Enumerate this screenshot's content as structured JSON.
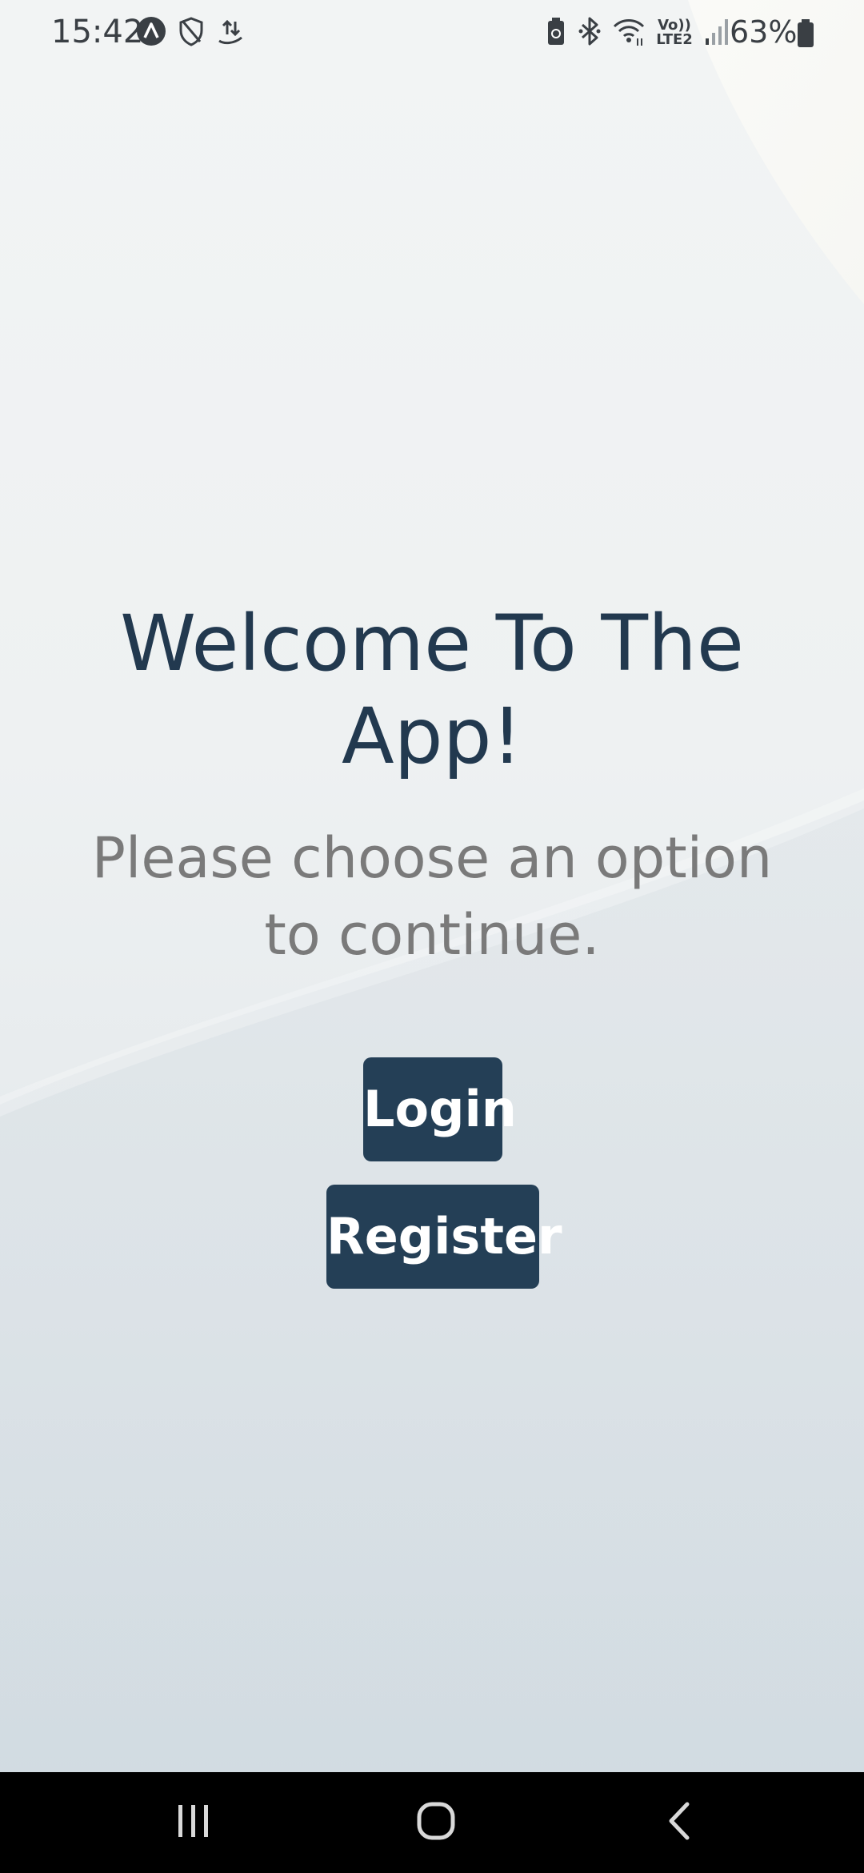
{
  "status_bar": {
    "time": "15:42",
    "battery_percent": "63%",
    "network_label": "Vo)) LTE2",
    "icons_left": [
      "assistant-icon",
      "shield-icon",
      "data-transfer-icon"
    ],
    "icons_right": [
      "battery-saver-icon",
      "bluetooth-icon",
      "wifi-icon",
      "volte-icon",
      "signal-icon",
      "battery-icon"
    ]
  },
  "main": {
    "title": "Welcome To The App!",
    "subtitle": "Please choose an option to continue."
  },
  "actions": {
    "login_label": "Login",
    "register_label": "Register"
  },
  "nav_bar": {
    "buttons": [
      "recent-apps-icon",
      "home-icon",
      "back-icon"
    ]
  },
  "colors": {
    "title": "#22394f",
    "subtitle": "#7a7a7a",
    "button_bg": "#243f56",
    "button_text": "#ffffff",
    "nav_bg": "#000000"
  }
}
